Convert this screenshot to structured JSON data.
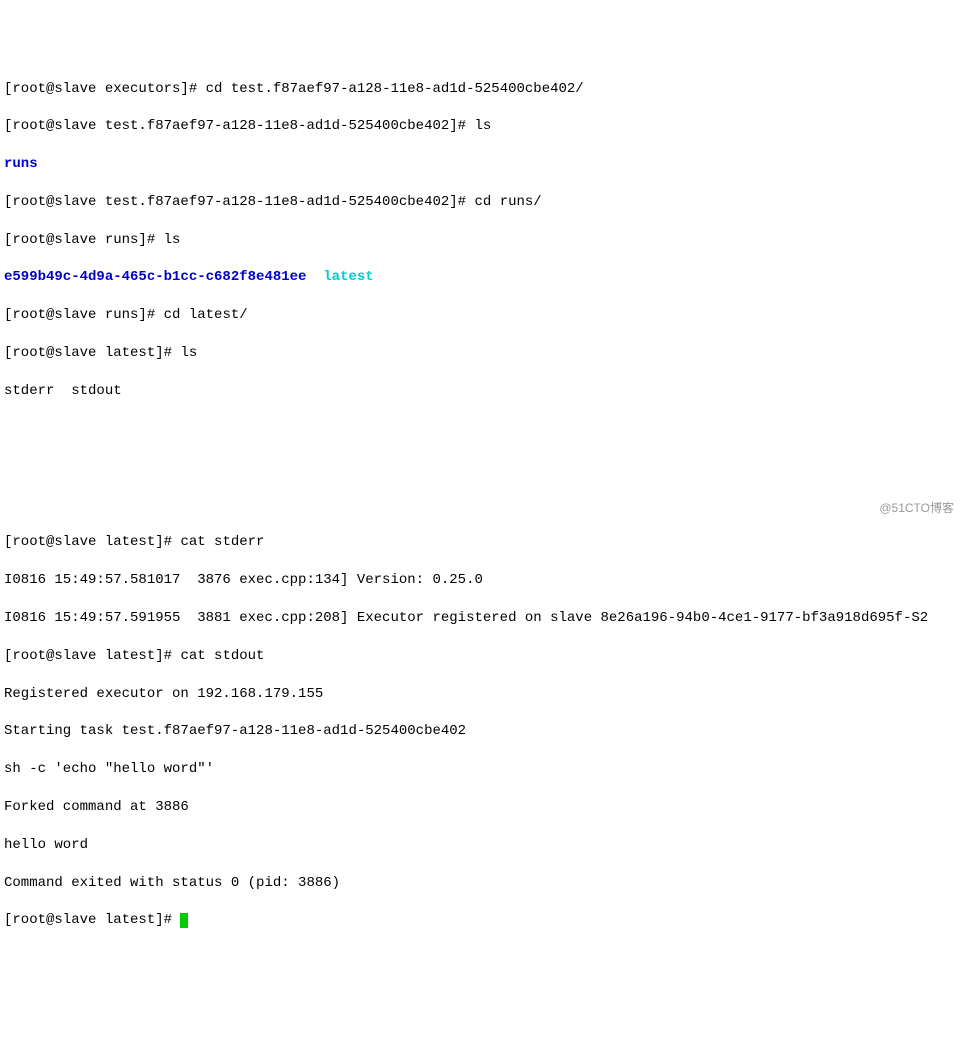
{
  "lines": {
    "l1_prompt": "[root@slave executors]# ",
    "l1_cmd": "cd test.f87aef97-a128-11e8-ad1d-525400cbe402/",
    "l2_prompt": "[root@slave test.f87aef97-a128-11e8-ad1d-525400cbe402]# ",
    "l2_cmd": "ls",
    "l3_out": "runs",
    "l4_prompt": "[root@slave test.f87aef97-a128-11e8-ad1d-525400cbe402]# ",
    "l4_cmd": "cd runs/",
    "l5_prompt": "[root@slave runs]# ",
    "l5_cmd": "ls",
    "l6_hash": "e599b49c-4d9a-465c-b1cc-c682f8e481ee",
    "l6_sep": "  ",
    "l6_latest": "latest",
    "l7_prompt": "[root@slave runs]# ",
    "l7_cmd": "cd latest/",
    "l8_prompt": "[root@slave latest]# ",
    "l8_cmd": "ls",
    "l9_out": "stderr  stdout",
    "l10_prompt": "[root@slave latest]# ",
    "l10_cmd": "cat stderr",
    "l11": "I0816 15:49:57.581017  3876 exec.cpp:134] Version: 0.25.0",
    "l12": "I0816 15:49:57.591955  3881 exec.cpp:208] Executor registered on slave 8e26a196-94b0-4ce1-9177-bf3a918d695f-S2",
    "l13_prompt": "[root@slave latest]# ",
    "l13_cmd": "cat stdout",
    "l14": "Registered executor on 192.168.179.155",
    "l15": "Starting task test.f87aef97-a128-11e8-ad1d-525400cbe402",
    "l16": "sh -c 'echo \"hello word\"'",
    "l17": "Forked command at 3886",
    "l18": "hello word",
    "l19": "Command exited with status 0 (pid: 3886)",
    "l20_prompt": "[root@slave latest]# "
  },
  "watermark": "@51CTO博客"
}
